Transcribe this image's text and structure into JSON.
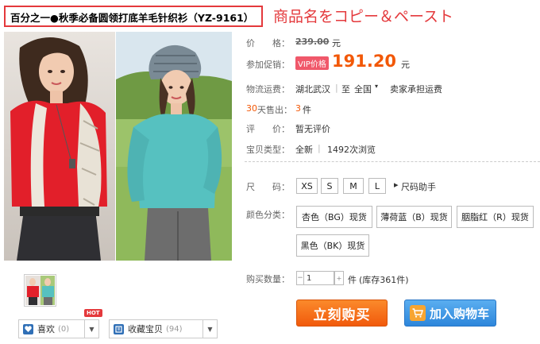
{
  "product": {
    "title": "百分之一●秋季必备圆领打底羊毛针织衫（YZ-9161）",
    "annotation": "商品名をコピー＆ペースト",
    "price_label": "价　　格：",
    "original_price": "239.00",
    "currency_unit": "元",
    "promo_label": "参加促销：",
    "vip_badge": "VIP价格",
    "promo_price": "191.20",
    "shipping_label": "物流运费：",
    "ship_from": "湖北武汉",
    "ship_sep": "|",
    "ship_to_prefix": "至",
    "ship_to": "全国",
    "ship_note": "卖家承担运费",
    "sold_prefix": "30",
    "sold_label": "天售出：",
    "sold_count": "3",
    "sold_unit": "件",
    "review_label": "评　　价：",
    "review_value": "暂无评价",
    "type_label": "宝贝类型：",
    "type_value": "全新",
    "type_sep": "|",
    "views": "1492次浏览"
  },
  "size": {
    "label": "尺　　码：",
    "options": [
      "XS",
      "S",
      "M",
      "L"
    ],
    "helper": "尺码助手"
  },
  "color": {
    "label": "颜色分类：",
    "options": [
      "杏色（BG）现货",
      "薄荷蓝（B）现货",
      "胭脂红（R）现货",
      "黑色（BK）现货"
    ]
  },
  "quantity": {
    "label": "购买数量：",
    "value": "1",
    "unit": "件",
    "stock": "(库存361件)"
  },
  "actions": {
    "buy_label": "立刻购买",
    "cart_label": "加入购物车",
    "like_label": "喜欢",
    "like_count": "(0)",
    "hot_badge": "HOT",
    "fav_label": "收藏宝贝",
    "fav_count": "(94)"
  },
  "colors": {
    "accent_red": "#e4393c",
    "price_orange": "#f25807",
    "buy_orange": "#f15a0c",
    "cart_blue": "#2d86db"
  }
}
